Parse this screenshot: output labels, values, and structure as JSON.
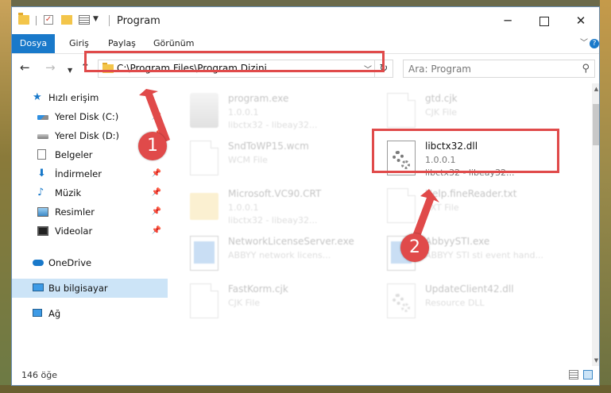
{
  "window": {
    "title": "Program"
  },
  "ribbon": {
    "tabs": [
      "Dosya",
      "Giriş",
      "Paylaş",
      "Görünüm"
    ]
  },
  "address": {
    "path": "C:\\Program Files\\Program Dizini"
  },
  "search": {
    "placeholder": "Ara: Program"
  },
  "sidebar": {
    "items": [
      {
        "label": "Hızlı erişim",
        "icon": "star-icon"
      },
      {
        "label": "Yerel Disk (C:)",
        "icon": "drive-icon"
      },
      {
        "label": "Yerel Disk (D:)",
        "icon": "drive-icon"
      },
      {
        "label": "Belgeler",
        "icon": "documents-icon"
      },
      {
        "label": "İndirmeler",
        "icon": "download-icon"
      },
      {
        "label": "Müzik",
        "icon": "music-icon"
      },
      {
        "label": "Resimler",
        "icon": "pictures-icon"
      },
      {
        "label": "Videolar",
        "icon": "videos-icon"
      },
      {
        "label": "OneDrive",
        "icon": "cloud-icon"
      },
      {
        "label": "Bu bilgisayar",
        "icon": "computer-icon"
      },
      {
        "label": "Ağ",
        "icon": "network-icon"
      }
    ]
  },
  "files": [
    {
      "name": "program.exe",
      "line2": "1.0.0.1",
      "line3": "libctx32 - libeay32...",
      "icon": "exe-icon"
    },
    {
      "name": "gtd.cjk",
      "line2": "CJK File",
      "line3": "",
      "icon": "file-icon"
    },
    {
      "name": "SndToWP15.wcm",
      "line2": "WCM File",
      "line3": "",
      "icon": "file-icon"
    },
    {
      "name": "libctx32.dll",
      "line2": "1.0.0.1",
      "line3": "libctx32 - libeay32...",
      "icon": "dll-gear-icon"
    },
    {
      "name": "Microsoft.VC90.CRT",
      "line2": "1.0.0.1",
      "line3": "libctx32 - libeay32...",
      "icon": "folder-icon"
    },
    {
      "name": "Help.fineReader.txt",
      "line2": "TXT File",
      "line3": "",
      "icon": "file-icon"
    },
    {
      "name": "NetworkLicenseServer.exe",
      "line2": "ABBYY network licens...",
      "line3": "",
      "icon": "app-icon"
    },
    {
      "name": "AbbyySTI.exe",
      "line2": "ABBYY STI sti event hand...",
      "line3": "",
      "icon": "app-icon"
    },
    {
      "name": "FastKorm.cjk",
      "line2": "CJK File",
      "line3": "",
      "icon": "file-icon"
    },
    {
      "name": "UpdateClient42.dll",
      "line2": "Resource DLL",
      "line3": "",
      "icon": "dll-gear-icon"
    }
  ],
  "status": {
    "item_count": "146 öğe"
  },
  "badges": {
    "one": "1",
    "two": "2"
  },
  "colors": {
    "accent": "#1979ca",
    "highlight": "#e04a4a",
    "selection": "#cce4f7"
  }
}
